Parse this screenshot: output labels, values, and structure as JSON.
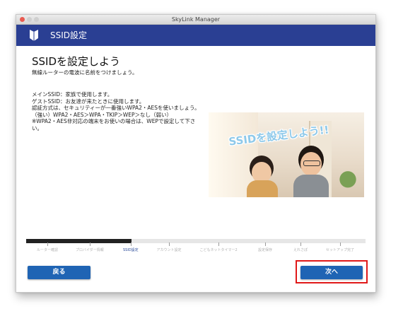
{
  "window": {
    "title": "SkyLink Manager"
  },
  "header": {
    "title": "SSID設定"
  },
  "page": {
    "title": "SSIDを設定しよう",
    "subtitle": "無線ルーターの電波に名前をつけましょう。",
    "description_lines": [
      "メインSSID：家族で使用します。",
      "ゲストSSID：お友達が来たときに使用します。",
      "認証方式は、セキュリティーが一番強いWPA2・AESを使いましょう。",
      "（強い）WPA2・AES＞WPA・TKIP＞WEP＞なし（弱い）",
      "※WPA2・AES非対応の端末をお使いの場合は、WEPで設定して下さい。"
    ],
    "promo_caption": "SSIDを設定しよう!!"
  },
  "steps": {
    "items": [
      "ルーター確認",
      "プロバイダー情報",
      "SSID設定",
      "アカウント設定",
      "こどもネットタイマー2",
      "設定保存",
      "えれさぽ",
      "セットアップ完了"
    ],
    "current_index": 2,
    "progress_fraction": 0.31
  },
  "buttons": {
    "back": "戻る",
    "next": "次へ"
  },
  "colors": {
    "header_bg": "#2a3f93",
    "button_bg": "#1f64b4",
    "highlight": "#e01818",
    "close_button": "#e95a50"
  }
}
